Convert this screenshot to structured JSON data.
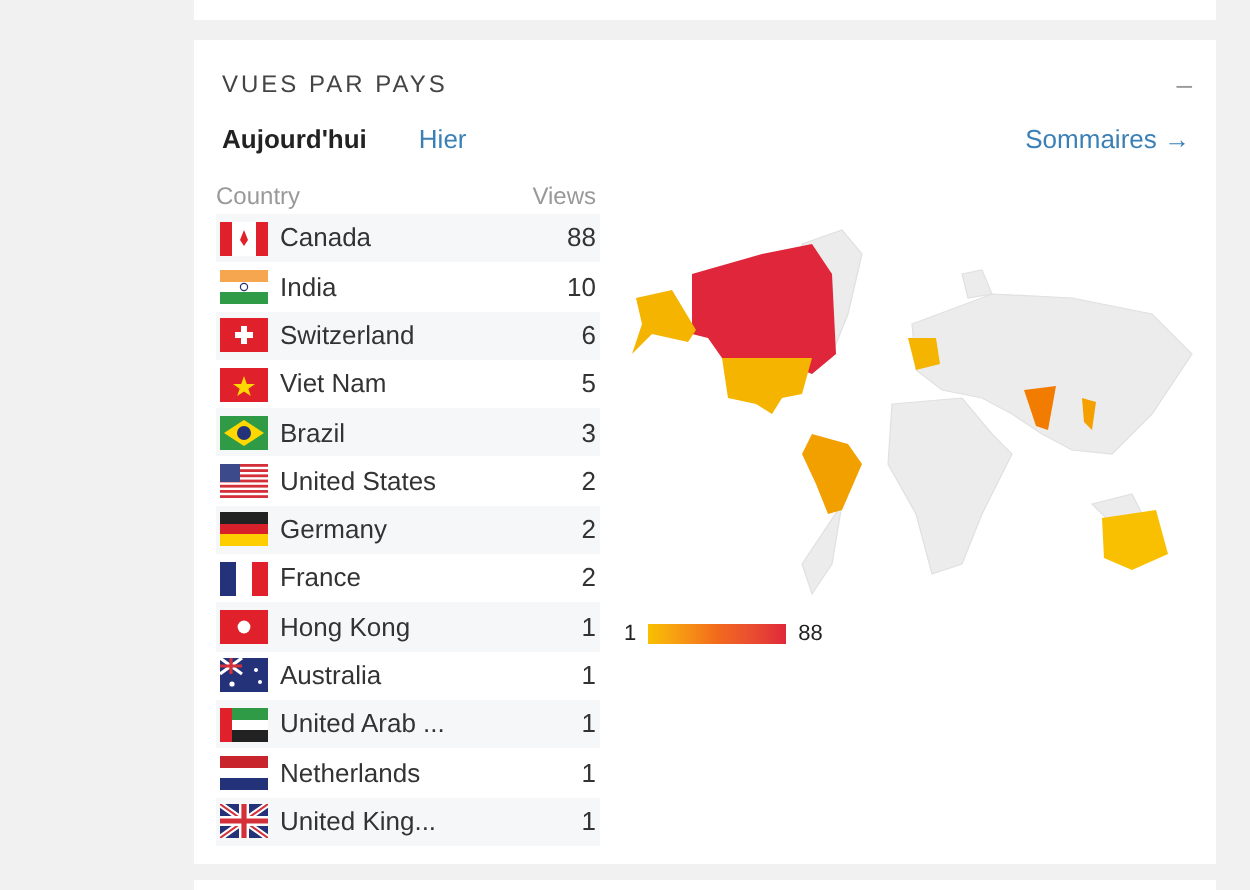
{
  "panel": {
    "title": "VUES PAR PAYS",
    "collapse_glyph": "–"
  },
  "tabs": [
    {
      "label": "Aujourd'hui",
      "selected": true
    },
    {
      "label": "Hier",
      "selected": false
    }
  ],
  "summary_link": {
    "label": "Sommaires",
    "arrow": "→"
  },
  "table": {
    "columns": [
      "Country",
      "Views"
    ],
    "rows": [
      {
        "kind": "ca",
        "country": "Canada",
        "views": "88"
      },
      {
        "kind": "in",
        "country": "India",
        "views": "10"
      },
      {
        "kind": "ch",
        "country": "Switzerland",
        "views": "6"
      },
      {
        "kind": "vn",
        "country": "Viet Nam",
        "views": "5"
      },
      {
        "kind": "br",
        "country": "Brazil",
        "views": "3"
      },
      {
        "kind": "us",
        "country": "United States",
        "views": "2"
      },
      {
        "kind": "de",
        "country": "Germany",
        "views": "2"
      },
      {
        "kind": "fr",
        "country": "France",
        "views": "2"
      },
      {
        "kind": "hk",
        "country": "Hong Kong",
        "views": "1"
      },
      {
        "kind": "au",
        "country": "Australia",
        "views": "1"
      },
      {
        "kind": "ae",
        "country": "United Arab ...",
        "views": "1"
      },
      {
        "kind": "nl",
        "country": "Netherlands",
        "views": "1"
      },
      {
        "kind": "gb",
        "country": "United King...",
        "views": "1"
      }
    ]
  },
  "legend": {
    "min": "1",
    "max": "88"
  }
}
